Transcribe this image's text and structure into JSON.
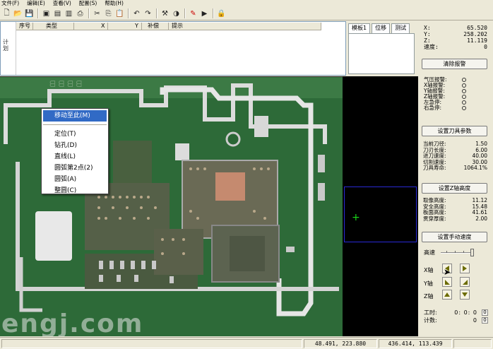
{
  "menu": [
    "文件(F)",
    "编辑(E)",
    "查看(V)",
    "配置(S)",
    "帮助(H)"
  ],
  "toolbar": {
    "icons": [
      "new-file-icon",
      "open-folder-icon",
      "save-icon",
      "camera-icon",
      "disk-icon",
      "page-icon",
      "print-icon",
      "cut-icon",
      "copy-icon",
      "paste-icon",
      "undo-icon",
      "redo-icon",
      "tools-icon",
      "contrast-icon",
      "pen-icon",
      "play-icon",
      "lock-icon"
    ]
  },
  "table": {
    "side_label": "计划",
    "columns": [
      "序号",
      "类型",
      "X",
      "Y",
      "补偿",
      "提示"
    ]
  },
  "tabs": [
    "模板1",
    "位移",
    "测试"
  ],
  "coords": {
    "x_label": "X:",
    "x_value": "65.520",
    "y_label": "Y:",
    "y_value": "258.202",
    "z_label": "Z:",
    "z_value": "11.119",
    "speed_label": "速度:",
    "speed_value": "0"
  },
  "clear_alarm_button": "清除报警",
  "alarms": [
    "气压报警:",
    "X轴报警:",
    "Y轴报警:",
    "Z轴报警:",
    "左急停:",
    "右急停:"
  ],
  "tool_params_button": "设置刀具参数",
  "tool_params": [
    {
      "label": "当前刀径:",
      "value": "1.50"
    },
    {
      "label": "刀刃长度:",
      "value": "6.00"
    },
    {
      "label": "进刀速度:",
      "value": "40.00"
    },
    {
      "label": "切割速度:",
      "value": "30.00"
    },
    {
      "label": "刀具寿命:",
      "value": "1064.1%"
    }
  ],
  "z_height_button": "设置Z轴高度",
  "z_params": [
    {
      "label": "取像高度:",
      "value": "11.12"
    },
    {
      "label": "安全高度:",
      "value": "15.48"
    },
    {
      "label": "板面高度:",
      "value": "41.61"
    },
    {
      "label": "贯穿厚度:",
      "value": "2.00"
    }
  ],
  "manual_speed_button": "设置手动速度",
  "speed_label": "高速",
  "axes": {
    "x": "X轴",
    "y": "Y轴",
    "z": "Z轴"
  },
  "work": {
    "time_label": "工时:",
    "time_value": "0: 0: 0",
    "count_label": "计数:",
    "count_value": "0",
    "reset": "0"
  },
  "context_menu": {
    "items": [
      "移动至此(M)",
      "定位(T)",
      "钻孔(D)",
      "直线(L)",
      "圆弧第2点(2)",
      "圆弧(A)",
      "整圆(C)"
    ]
  },
  "watermark": "engj.com",
  "status": {
    "pos1": "48.491,    223.880",
    "pos2": "436.414,    113.439"
  }
}
